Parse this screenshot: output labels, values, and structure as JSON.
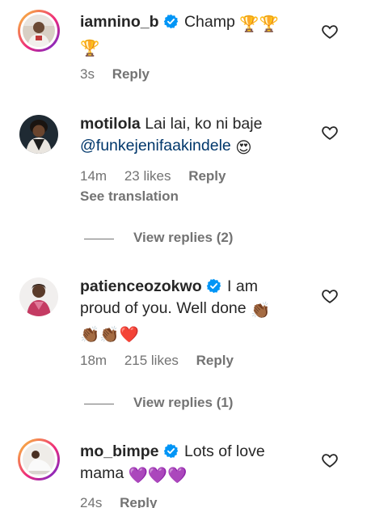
{
  "comments": [
    {
      "username": "iamnino_b",
      "verified": true,
      "text": "Champ",
      "emojis_inline": "🏆🏆",
      "emojis_line2": "🏆",
      "time": "3s",
      "likes": "",
      "reply_label": "Reply"
    },
    {
      "username": "motilola",
      "verified": false,
      "text": "Lai lai, ko ni baje",
      "mention": "@funkejenifaakindele",
      "emoji": "😍",
      "time": "14m",
      "likes": "23 likes",
      "reply_label": "Reply",
      "see_translation": "See translation",
      "view_replies": "View replies (2)"
    },
    {
      "username": "patienceozokwo",
      "verified": true,
      "text_line1": "I am",
      "text_line2": "proud of you. Well done",
      "emoji_line2": "👏🏾",
      "emoji_line3": "👏🏾👏🏾❤️",
      "time": "18m",
      "likes": "215 likes",
      "reply_label": "Reply",
      "view_replies": "View replies (1)"
    },
    {
      "username": "mo_bimpe",
      "verified": true,
      "text_line1": "Lots of love",
      "text_line2": "mama",
      "emoji_line2": "💜💜💜",
      "time": "24s",
      "reply_label": "Reply"
    }
  ],
  "colors": {
    "text": "#262626",
    "secondary": "#737373",
    "mention": "#00376b",
    "verified": "#0095f6"
  }
}
